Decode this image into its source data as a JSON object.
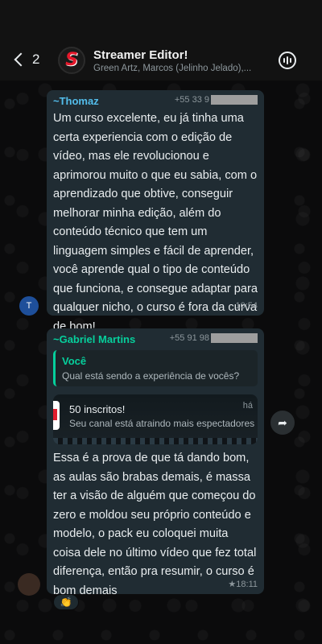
{
  "header": {
    "back_count": "2",
    "group_title": "Streamer Editor!",
    "group_subtitle": "Green Artz, Marcos (Jelinho Jelado),...",
    "logo_letter": "S"
  },
  "messages": [
    {
      "sender": "~Thomaz",
      "sender_color": "#53bdeb",
      "phone_prefix": "+55 33 9",
      "text": "Um curso excelente, eu já tinha uma certa experiencia com o edição de vídeo, mas ele revolucionou e aprimorou muito o que eu sabia, com o aprendizado que obtive, conseguir melhorar minha edição, além do conteúdo técnico que tem um linguagem simples e fácil de aprender, você aprende qual o tipo de conteúdo que funciona, e consegue adaptar para qualquer nicho, o curso é fora da curva de bom!",
      "time": "10:54",
      "avatar_letter": "T"
    },
    {
      "sender": "~Gabriel Martins",
      "sender_color": "#06cf9c",
      "phone_prefix": "+55 91 98",
      "quote_author": "Você",
      "quote_text": "Qual está sendo a experiência de vocês?",
      "notif_title": "50 inscritos!",
      "notif_subtitle": "Seu canal está atraindo mais espectadores",
      "notif_time": "há",
      "text": "Essa é a prova de que tá dando bom, as aulas são brabas demais, é massa ter a visão de alguém que começou do zero e moldou seu próprio conteúdo e modelo, o pack eu coloquei muita coisa dele no último vídeo que fez total diferença, então pra resumir, o curso é bom demais",
      "time": "★18:11",
      "reaction": "👏"
    }
  ]
}
